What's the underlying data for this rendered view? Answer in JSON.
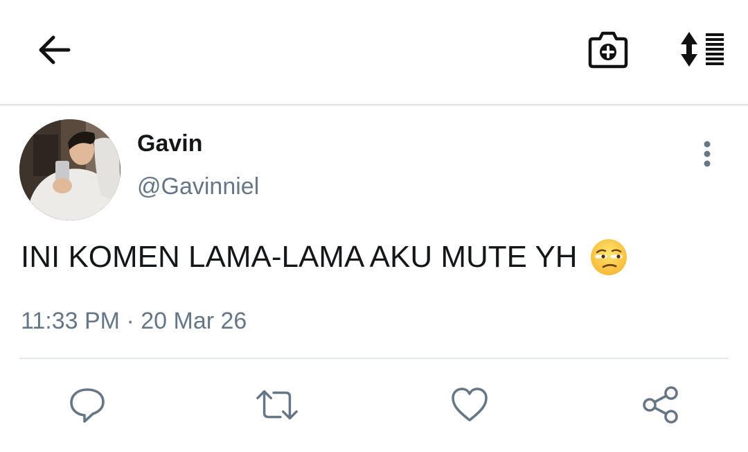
{
  "header": {
    "back_icon": "arrow-left-icon",
    "camera_icon": "camera-plus-icon",
    "sort_icon": "sort-list-icon"
  },
  "tweet": {
    "author_name": "Gavin",
    "author_handle": "@Gavinniel",
    "text": "INI KOMEN LAMA-LAMA AKU MUTE YH",
    "emoji": "unamused-face-emoji",
    "time": "11:33 PM",
    "separator": "·",
    "date": "20 Mar 26"
  },
  "actions": {
    "reply_icon": "reply-icon",
    "retweet_icon": "retweet-icon",
    "like_icon": "heart-icon",
    "share_icon": "share-icon"
  },
  "colors": {
    "text_primary": "#14171a",
    "text_secondary": "#657786",
    "icon_gray": "#657786",
    "divider": "#e1e8ed"
  }
}
